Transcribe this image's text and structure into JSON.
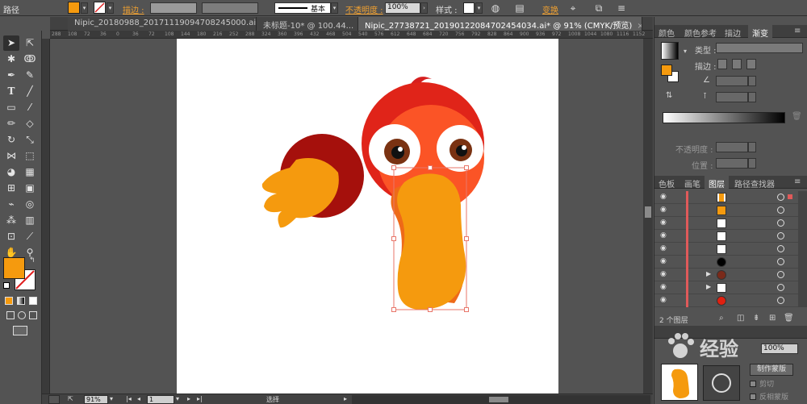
{
  "control_bar": {
    "object_type": "路径",
    "stroke_label": "描边 :",
    "stroke_style": "基本",
    "opacity_label": "不透明度 :",
    "opacity_value": "100%",
    "style_label": "样式 :",
    "transform_label": "变换",
    "fill_color": "#f59a0e"
  },
  "tabs": [
    {
      "label": "Nipic_20180988_20171119094708245000.ai*",
      "active": false
    },
    {
      "label": "未标题-10* @ 100.44...",
      "active": false
    },
    {
      "label": "Nipic_27738721_20190122084702454034.ai* @ 91% (CMYK/预览)",
      "active": true
    }
  ],
  "ruler": {
    "ticks": [
      "288",
      "108",
      "72",
      "36",
      "0",
      "36",
      "72",
      "108",
      "144",
      "180",
      "216",
      "252",
      "288",
      "324",
      "360",
      "396",
      "432",
      "468",
      "504",
      "540",
      "576",
      "612",
      "648",
      "684",
      "720",
      "756",
      "792",
      "828",
      "864",
      "900",
      "936",
      "972",
      "1008",
      "1044",
      "1080",
      "1116",
      "1152"
    ]
  },
  "toolbar": {
    "fill_color": "#f59a0e"
  },
  "status_bar": {
    "zoom": "91%",
    "page": "1",
    "mode": "选择"
  },
  "gradient_panel": {
    "tabs": [
      "颜色",
      "颜色参考",
      "描边",
      "渐变"
    ],
    "active_tab": "渐变",
    "type_label": "类型 :",
    "stroke_label": "描边 :",
    "opacity_label": "不透明度 :",
    "position_label": "位置 :"
  },
  "layers_panel": {
    "tabs": [
      "色板",
      "画笔",
      "图层",
      "路径查找器"
    ],
    "active_tab": "图层",
    "footer_text": "2 个图层",
    "rows": [
      {
        "thumb_color": "#f59a0e",
        "expandable": false,
        "selected": true
      },
      {
        "thumb_color": "#f59a0e",
        "expandable": false,
        "selected": false
      },
      {
        "thumb_color": "#ffffff",
        "expandable": false,
        "selected": false
      },
      {
        "thumb_color": "#ffffff",
        "expandable": false,
        "selected": false
      },
      {
        "thumb_color": "#ffffff",
        "expandable": false,
        "selected": false
      },
      {
        "thumb_color": "#000000",
        "expandable": false,
        "selected": false
      },
      {
        "thumb_color": "#7a2a1a",
        "expandable": true,
        "selected": false
      },
      {
        "thumb_color": "#ffffff",
        "expandable": true,
        "selected": false
      },
      {
        "thumb_color": "#e02010",
        "expandable": false,
        "selected": false
      }
    ]
  },
  "transparency_panel": {
    "opacity_value": "100%",
    "make_mask_button": "制作蒙版",
    "clip_label": "剪切",
    "invert_mask_label": "反相蒙版"
  },
  "watermark": {
    "text": "经验"
  }
}
